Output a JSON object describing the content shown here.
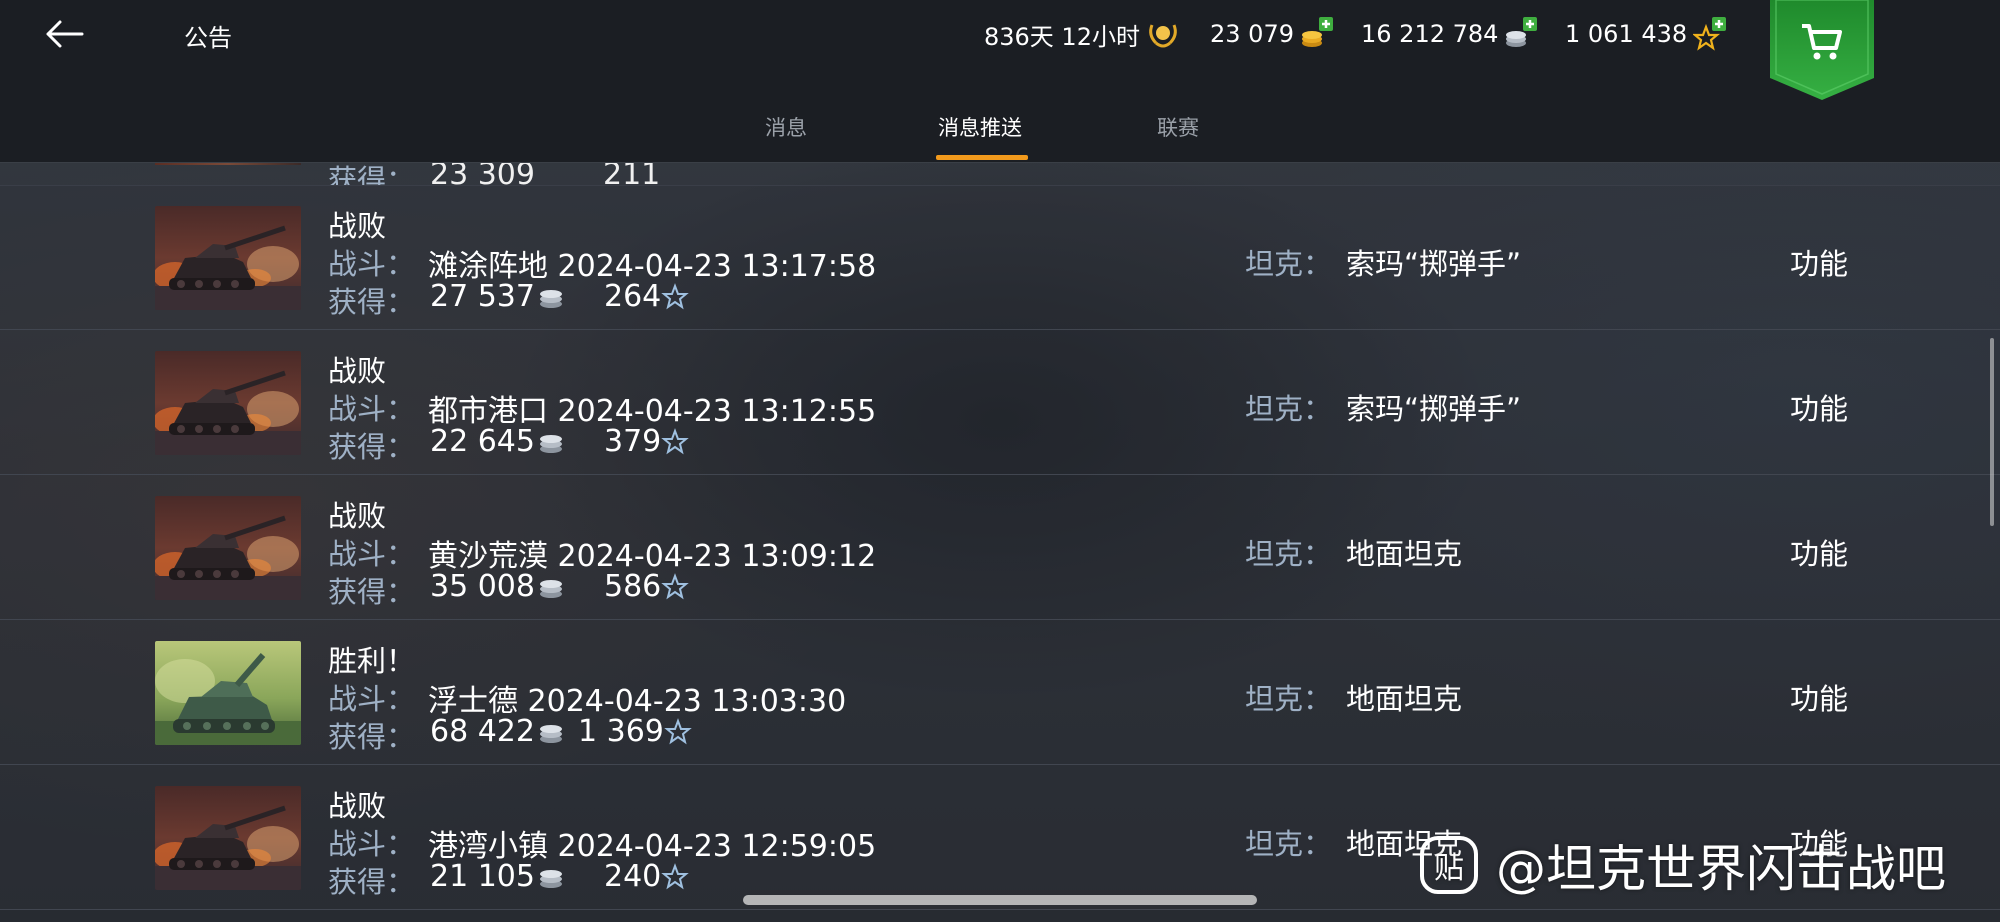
{
  "header": {
    "title": "公告",
    "currencies": [
      {
        "value": "836天 12小时",
        "icon": "premium-laurel-icon"
      },
      {
        "value": "23 079",
        "icon": "gold-coin-add-icon"
      },
      {
        "value": "16 212 784",
        "icon": "silver-credits-add-icon"
      },
      {
        "value": "1 061 438",
        "icon": "free-xp-star-add-icon"
      }
    ]
  },
  "tabs": [
    {
      "label": "消息",
      "active": false
    },
    {
      "label": "消息推送",
      "active": true
    },
    {
      "label": "联赛",
      "active": false
    }
  ],
  "partial_row": {
    "earn_label": "获得：",
    "credits": "23 309",
    "xp": "211"
  },
  "rows": [
    {
      "result": "战败",
      "battle_label": "战斗：",
      "map_time": "滩涂阵地 2024-04-23 13:17:58",
      "earn_label": "获得：",
      "credits": "27 537",
      "xp": "264",
      "tank_label": "坦克：",
      "tank": "索玛“掷弹手”",
      "action": "功能",
      "thumb": "defeat"
    },
    {
      "result": "战败",
      "battle_label": "战斗：",
      "map_time": "都市港口 2024-04-23 13:12:55",
      "earn_label": "获得：",
      "credits": "22 645",
      "xp": "379",
      "tank_label": "坦克：",
      "tank": "索玛“掷弹手”",
      "action": "功能",
      "thumb": "defeat"
    },
    {
      "result": "战败",
      "battle_label": "战斗：",
      "map_time": "黄沙荒漠 2024-04-23 13:09:12",
      "earn_label": "获得：",
      "credits": "35 008",
      "xp": "586",
      "tank_label": "坦克：",
      "tank": "地面坦克",
      "action": "功能",
      "thumb": "defeat"
    },
    {
      "result": "胜利！",
      "battle_label": "战斗：",
      "map_time": "浮士德 2024-04-23 13:03:30",
      "earn_label": "获得：",
      "credits": "68 422",
      "xp": "1 369",
      "tank_label": "坦克：",
      "tank": "地面坦克",
      "action": "功能",
      "thumb": "victory"
    },
    {
      "result": "战败",
      "battle_label": "战斗：",
      "map_time": "港湾小镇 2024-04-23 12:59:05",
      "earn_label": "获得：",
      "credits": "21 105",
      "xp": "240",
      "tank_label": "坦克：",
      "tank": "地面坦克",
      "action": "功能",
      "thumb": "defeat"
    }
  ],
  "watermark": {
    "logo_text": "贴",
    "text": "@坦克世界闪击战吧"
  },
  "colors": {
    "accent_tab": "#f29a1c",
    "shop_green": "#2ea33a",
    "label_blue": "#9fb1c6",
    "gold": "#f0b21c"
  }
}
